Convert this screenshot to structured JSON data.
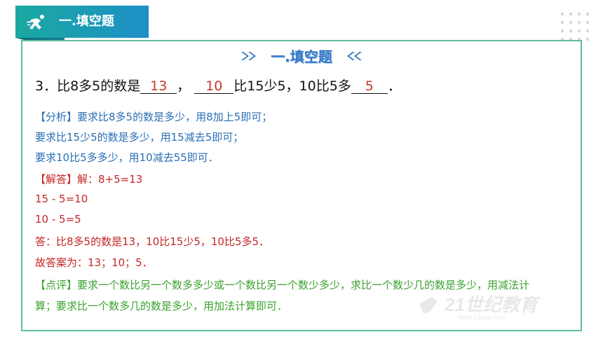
{
  "tab_title": "一.填空题",
  "section_title": "一.填空题",
  "question": {
    "prefix": "3．比8多5的数是",
    "blank1": "13",
    "sep": "，",
    "blank2": "10",
    "mid": "比15少5，10比5多",
    "blank3": "5",
    "suffix": "．"
  },
  "analysis": {
    "tag": "【分析】",
    "line1": "要求比8多5的数是多少，用8加上5即可；",
    "line2": "要求比15少5的数是多少，用15减去5即可；",
    "line3": "要求10比5多多少，用10减去55即可．"
  },
  "solution": {
    "tag": "【解答】",
    "line1": "解：8+5=13",
    "line2": "15 - 5=10",
    "line3": "10 - 5=5",
    "line4": "答：比8多5的数是13，10比15少5，10比5多5．",
    "line5": "故答案为：13；10；5．"
  },
  "comment": {
    "tag": "【点评】",
    "line1": "要求一个数比另一个数多多少或一个数比另一个数少多少，求比一个数少几的数是多少，用减法计",
    "line2": "算；要求比一个数多几的数是多少，用加法计算即可．"
  },
  "watermark": {
    "text": "21世纪教育",
    "url": "www.21cnjy.com"
  },
  "colors": {
    "analysis": "#2a6fb5",
    "solution": "#c42626",
    "comment": "#3aa12e",
    "header": "#3578c4"
  }
}
